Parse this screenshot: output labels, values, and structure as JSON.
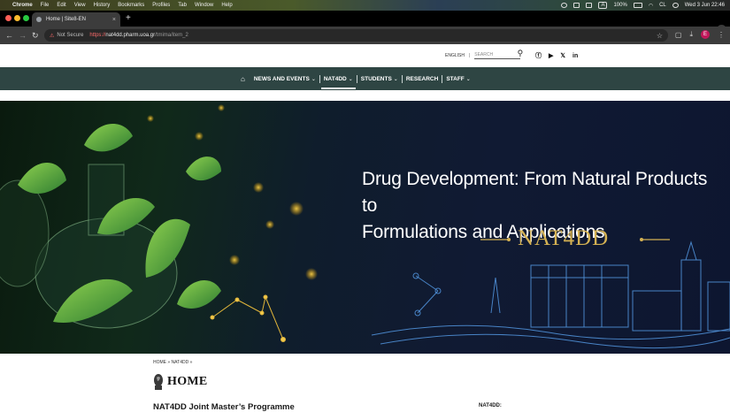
{
  "os_menubar": {
    "items": [
      "Chrome",
      "File",
      "Edit",
      "View",
      "History",
      "Bookmarks",
      "Profiles",
      "Tab",
      "Window",
      "Help"
    ],
    "battery": "100%",
    "clock": "Wed 3 Jun  22:46",
    "keyboard": "A",
    "lang": "CL"
  },
  "browser": {
    "tab": {
      "title": "Home | Site8-EN"
    },
    "address": {
      "security_label": "Not Secure",
      "scheme": "https://",
      "host": "nat4dd.pharm.uoa.gr",
      "path": "/tmima/item_2"
    },
    "profile_initial": "E"
  },
  "site": {
    "lang_label": "ENGLISH",
    "lang_sep": "|",
    "search_placeholder": "SEARCH",
    "social": [
      "facebook-icon",
      "youtube-icon",
      "x-icon",
      "linkedin-icon"
    ],
    "nav": {
      "items": [
        {
          "label": "NEWS AND EVENTS",
          "dropdown": true
        },
        {
          "label": "NAT4DD",
          "dropdown": true,
          "active": true
        },
        {
          "label": "STUDENTS",
          "dropdown": true
        },
        {
          "label": "RESEARCH",
          "dropdown": false
        },
        {
          "label": "STAFF",
          "dropdown": true
        }
      ]
    },
    "hero": {
      "title_line1": "Drug Development: From Natural Products to",
      "title_line2": "Formulations and Applications",
      "brand": "NAT4DD"
    },
    "breadcrumb": "HOME » NAT4DD »",
    "page_heading": "HOME",
    "programme_title": "NAT4DD Joint Master’s Programme",
    "sidebar_label": "NAT4DD:"
  },
  "colors": {
    "nav_bg": "#2e4543",
    "hero_gold": "#d4b153",
    "insecure_red": "#ff6b6b"
  }
}
